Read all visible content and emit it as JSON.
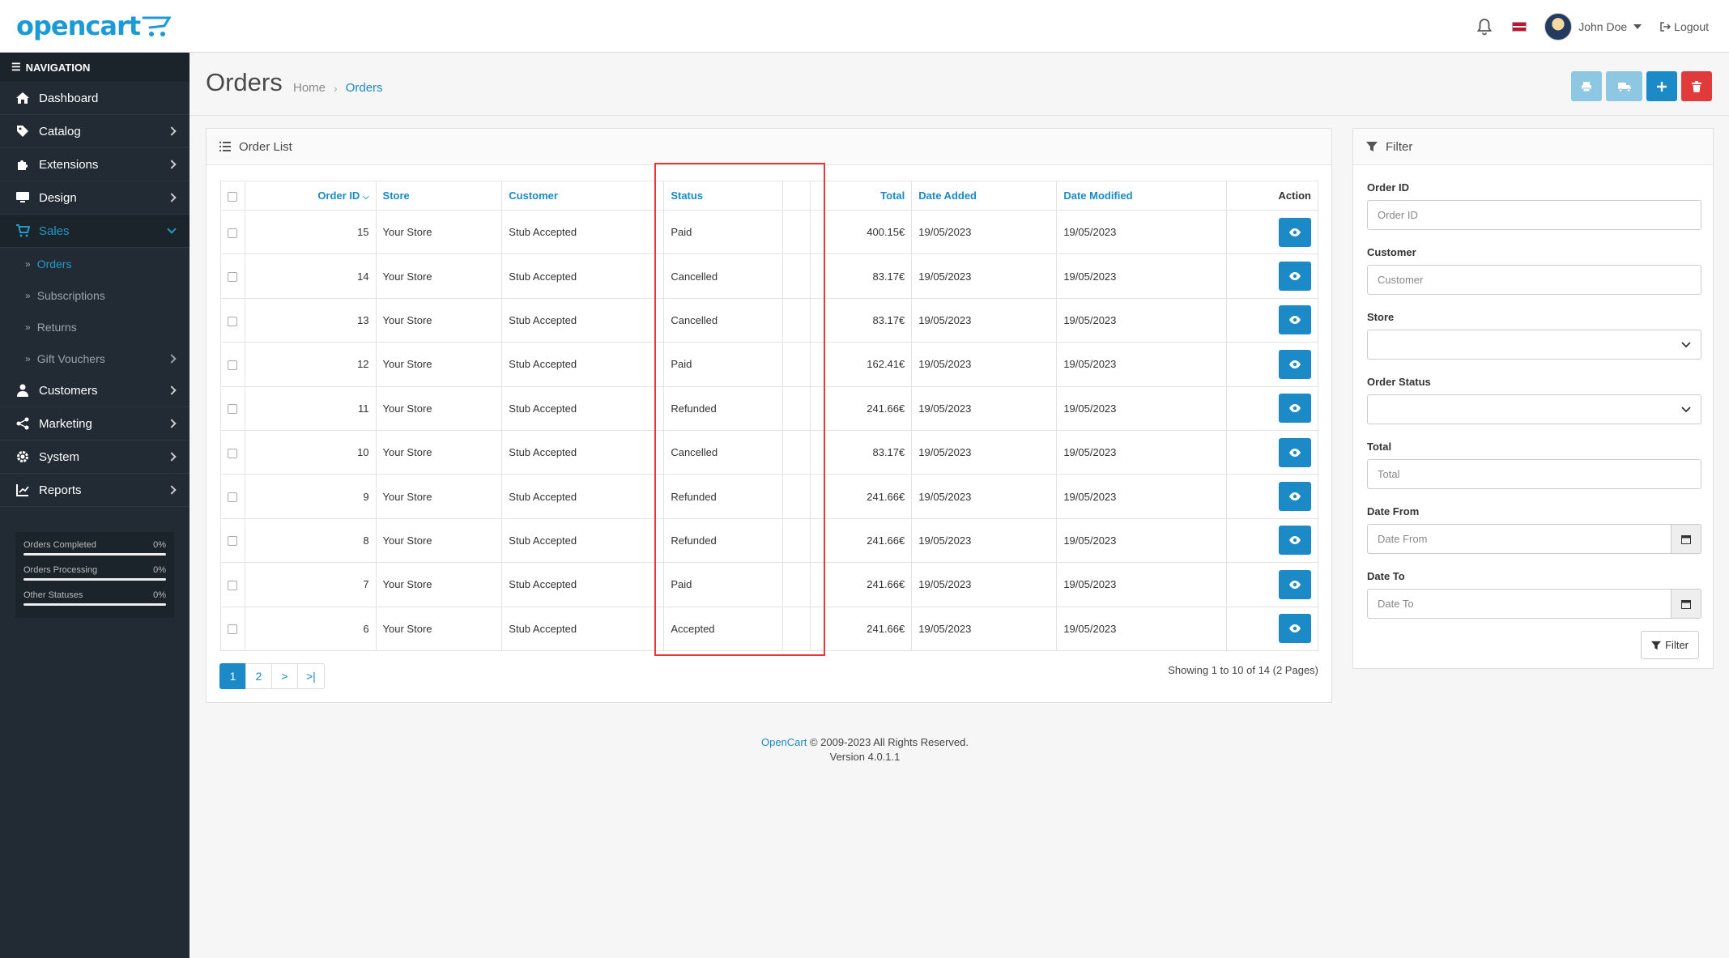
{
  "brand": {
    "logo_text": "opencart"
  },
  "header": {
    "user_name": "John Doe",
    "logout_label": "Logout"
  },
  "sidebar": {
    "heading": "NAVIGATION",
    "items": [
      {
        "label": "Dashboard",
        "icon": "home-icon"
      },
      {
        "label": "Catalog",
        "icon": "tag-icon"
      },
      {
        "label": "Extensions",
        "icon": "puzzle-icon"
      },
      {
        "label": "Design",
        "icon": "monitor-icon"
      },
      {
        "label": "Sales",
        "icon": "cart-icon"
      },
      {
        "label": "Customers",
        "icon": "user-icon"
      },
      {
        "label": "Marketing",
        "icon": "share-icon"
      },
      {
        "label": "System",
        "icon": "gear-icon"
      },
      {
        "label": "Reports",
        "icon": "chart-icon"
      }
    ],
    "sales_sub": [
      "Orders",
      "Subscriptions",
      "Returns",
      "Gift Vouchers"
    ],
    "stats": [
      {
        "label": "Orders Completed",
        "value": "0%"
      },
      {
        "label": "Orders Processing",
        "value": "0%"
      },
      {
        "label": "Other Statuses",
        "value": "0%"
      }
    ]
  },
  "page": {
    "title": "Orders",
    "breadcrumb": [
      "Home",
      "Orders"
    ]
  },
  "order_list": {
    "title": "Order List",
    "columns": {
      "order_id": "Order ID",
      "store": "Store",
      "customer": "Customer",
      "status": "Status",
      "total": "Total",
      "date_added": "Date Added",
      "date_modified": "Date Modified",
      "action": "Action"
    },
    "rows": [
      {
        "id": "15",
        "store": "Your Store",
        "customer": "Stub Accepted",
        "status": "Paid",
        "total": "400.15€",
        "added": "19/05/2023",
        "modified": "19/05/2023"
      },
      {
        "id": "14",
        "store": "Your Store",
        "customer": "Stub Accepted",
        "status": "Cancelled",
        "total": "83.17€",
        "added": "19/05/2023",
        "modified": "19/05/2023"
      },
      {
        "id": "13",
        "store": "Your Store",
        "customer": "Stub Accepted",
        "status": "Cancelled",
        "total": "83.17€",
        "added": "19/05/2023",
        "modified": "19/05/2023"
      },
      {
        "id": "12",
        "store": "Your Store",
        "customer": "Stub Accepted",
        "status": "Paid",
        "total": "162.41€",
        "added": "19/05/2023",
        "modified": "19/05/2023"
      },
      {
        "id": "11",
        "store": "Your Store",
        "customer": "Stub Accepted",
        "status": "Refunded",
        "total": "241.66€",
        "added": "19/05/2023",
        "modified": "19/05/2023"
      },
      {
        "id": "10",
        "store": "Your Store",
        "customer": "Stub Accepted",
        "status": "Cancelled",
        "total": "83.17€",
        "added": "19/05/2023",
        "modified": "19/05/2023"
      },
      {
        "id": "9",
        "store": "Your Store",
        "customer": "Stub Accepted",
        "status": "Refunded",
        "total": "241.66€",
        "added": "19/05/2023",
        "modified": "19/05/2023"
      },
      {
        "id": "8",
        "store": "Your Store",
        "customer": "Stub Accepted",
        "status": "Refunded",
        "total": "241.66€",
        "added": "19/05/2023",
        "modified": "19/05/2023"
      },
      {
        "id": "7",
        "store": "Your Store",
        "customer": "Stub Accepted",
        "status": "Paid",
        "total": "241.66€",
        "added": "19/05/2023",
        "modified": "19/05/2023"
      },
      {
        "id": "6",
        "store": "Your Store",
        "customer": "Stub Accepted",
        "status": "Accepted",
        "total": "241.66€",
        "added": "19/05/2023",
        "modified": "19/05/2023"
      }
    ],
    "pagination": [
      "1",
      "2",
      ">",
      ">|"
    ],
    "showing": "Showing 1 to 10 of 14 (2 Pages)"
  },
  "filter": {
    "title": "Filter",
    "order_id_label": "Order ID",
    "order_id_placeholder": "Order ID",
    "customer_label": "Customer",
    "customer_placeholder": "Customer",
    "store_label": "Store",
    "status_label": "Order Status",
    "total_label": "Total",
    "total_placeholder": "Total",
    "date_from_label": "Date From",
    "date_from_placeholder": "Date From",
    "date_to_label": "Date To",
    "date_to_placeholder": "Date To",
    "button_label": "Filter"
  },
  "footer": {
    "link": "OpenCart",
    "copyright": " © 2009-2023 All Rights Reserved.",
    "version": "Version 4.0.1.1"
  },
  "colors": {
    "accent": "#1b8ac6",
    "sidebar": "#222b34",
    "danger": "#e03a3a",
    "highlight": "#e53935"
  }
}
